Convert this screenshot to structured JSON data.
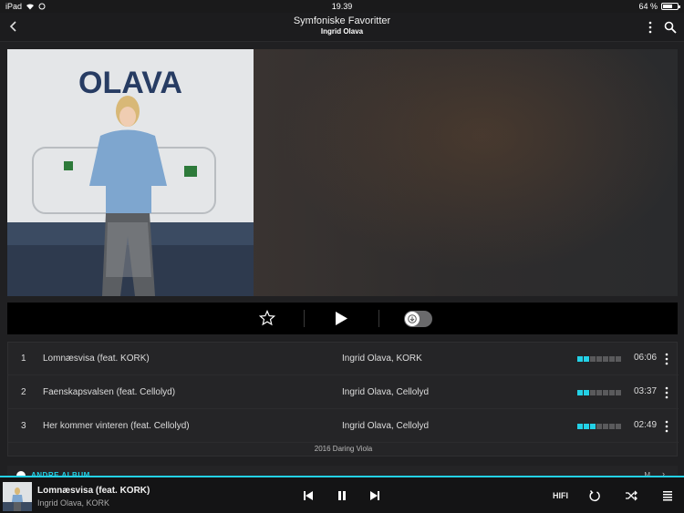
{
  "status_bar": {
    "device": "iPad",
    "time": "19.39",
    "battery": "64 %"
  },
  "header": {
    "title": "Symfoniske Favoritter",
    "subtitle": "Ingrid Olava"
  },
  "cover": {
    "banner_text": "OLAVA"
  },
  "tracks": [
    {
      "number": "1",
      "title": "Lomnæsvisa (feat. KORK)",
      "artist": "Ingrid Olava, KORK",
      "popularity": 2,
      "duration": "06:06"
    },
    {
      "number": "2",
      "title": "Faenskapsvalsen (feat. Cellolyd)",
      "artist": "Ingrid Olava, Cellolyd",
      "popularity": 2,
      "duration": "03:37"
    },
    {
      "number": "3",
      "title": "Her kommer vinteren (feat. Cellolyd)",
      "artist": "Ingrid Olava, Cellolyd",
      "popularity": 3,
      "duration": "02:49"
    }
  ],
  "album_note": "2016 Daring Viola",
  "andre_album": {
    "label": "ANDRE ALBUM",
    "more": "M"
  },
  "now_playing": {
    "title": "Lomnæsvisa (feat. KORK)",
    "artist": "Ingrid Olava, KORK",
    "quality": "HIFI"
  },
  "colors": {
    "accent": "#23d1e6",
    "background": "#202022"
  }
}
